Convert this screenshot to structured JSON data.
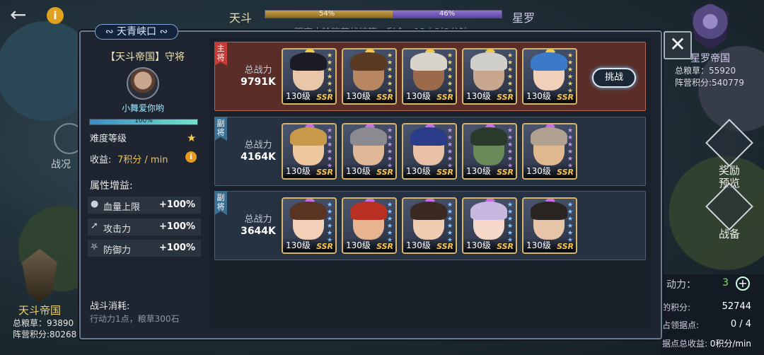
{
  "top": {
    "side_a": "天斗",
    "side_b": "星罗",
    "pct_a_label": "54%",
    "pct_b_label": "46%",
    "pct_a": 54,
    "countdown": "距离本轮阵营战结算，剩余：12小时2分钟"
  },
  "right_empire": {
    "name": "星罗帝国",
    "grain": "总粮草：55920",
    "camp_score": "阵营积分:540779"
  },
  "reward_label": "奖励\n预览",
  "reward_l1": "奖励",
  "reward_l2": "预览",
  "prep_label": "战备",
  "right_panel": {
    "action_label": "动力：",
    "action_value": "3",
    "score_label": "的积分:",
    "score_value": "52744",
    "occupy_label": "占领据点:",
    "occupy_value": "0 / 4",
    "income_label": "据点总收益:",
    "income_value": "0积分/min"
  },
  "left_empire": {
    "name": "天斗帝国",
    "grain": "总粮草：93890",
    "camp_score": "阵营积分:80268"
  },
  "battle_situation": "战况",
  "modal": {
    "location": "天青峡口",
    "owner_title": "【天斗帝国】守将",
    "owner_name": "小舞爱你哟",
    "difficulty_pct": "100%",
    "difficulty_label": "难度等级",
    "yield_label": "收益:",
    "yield_value": "7积分 / min",
    "attr_title": "属性增益:",
    "attrs": [
      {
        "name": "血量上限",
        "value": "+100%"
      },
      {
        "name": "攻击力",
        "value": "+100%"
      },
      {
        "name": "防御力",
        "value": "+100%"
      }
    ],
    "cost_title": "战斗消耗:",
    "cost_text": "行动力1点，粮草300石",
    "challenge_label": "挑战",
    "teams": [
      {
        "role": "主将",
        "power_label": "总战力",
        "power": "9791K",
        "cards": [
          "130级",
          "130级",
          "130级",
          "130级",
          "130级"
        ]
      },
      {
        "role": "副将",
        "power_label": "总战力",
        "power": "4164K",
        "cards": [
          "130级",
          "130级",
          "130级",
          "130级",
          "130级"
        ]
      },
      {
        "role": "副将",
        "power_label": "总战力",
        "power": "3644K",
        "cards": [
          "130级",
          "130级",
          "130级",
          "130级",
          "130级"
        ]
      }
    ],
    "rarity": "SSR"
  }
}
